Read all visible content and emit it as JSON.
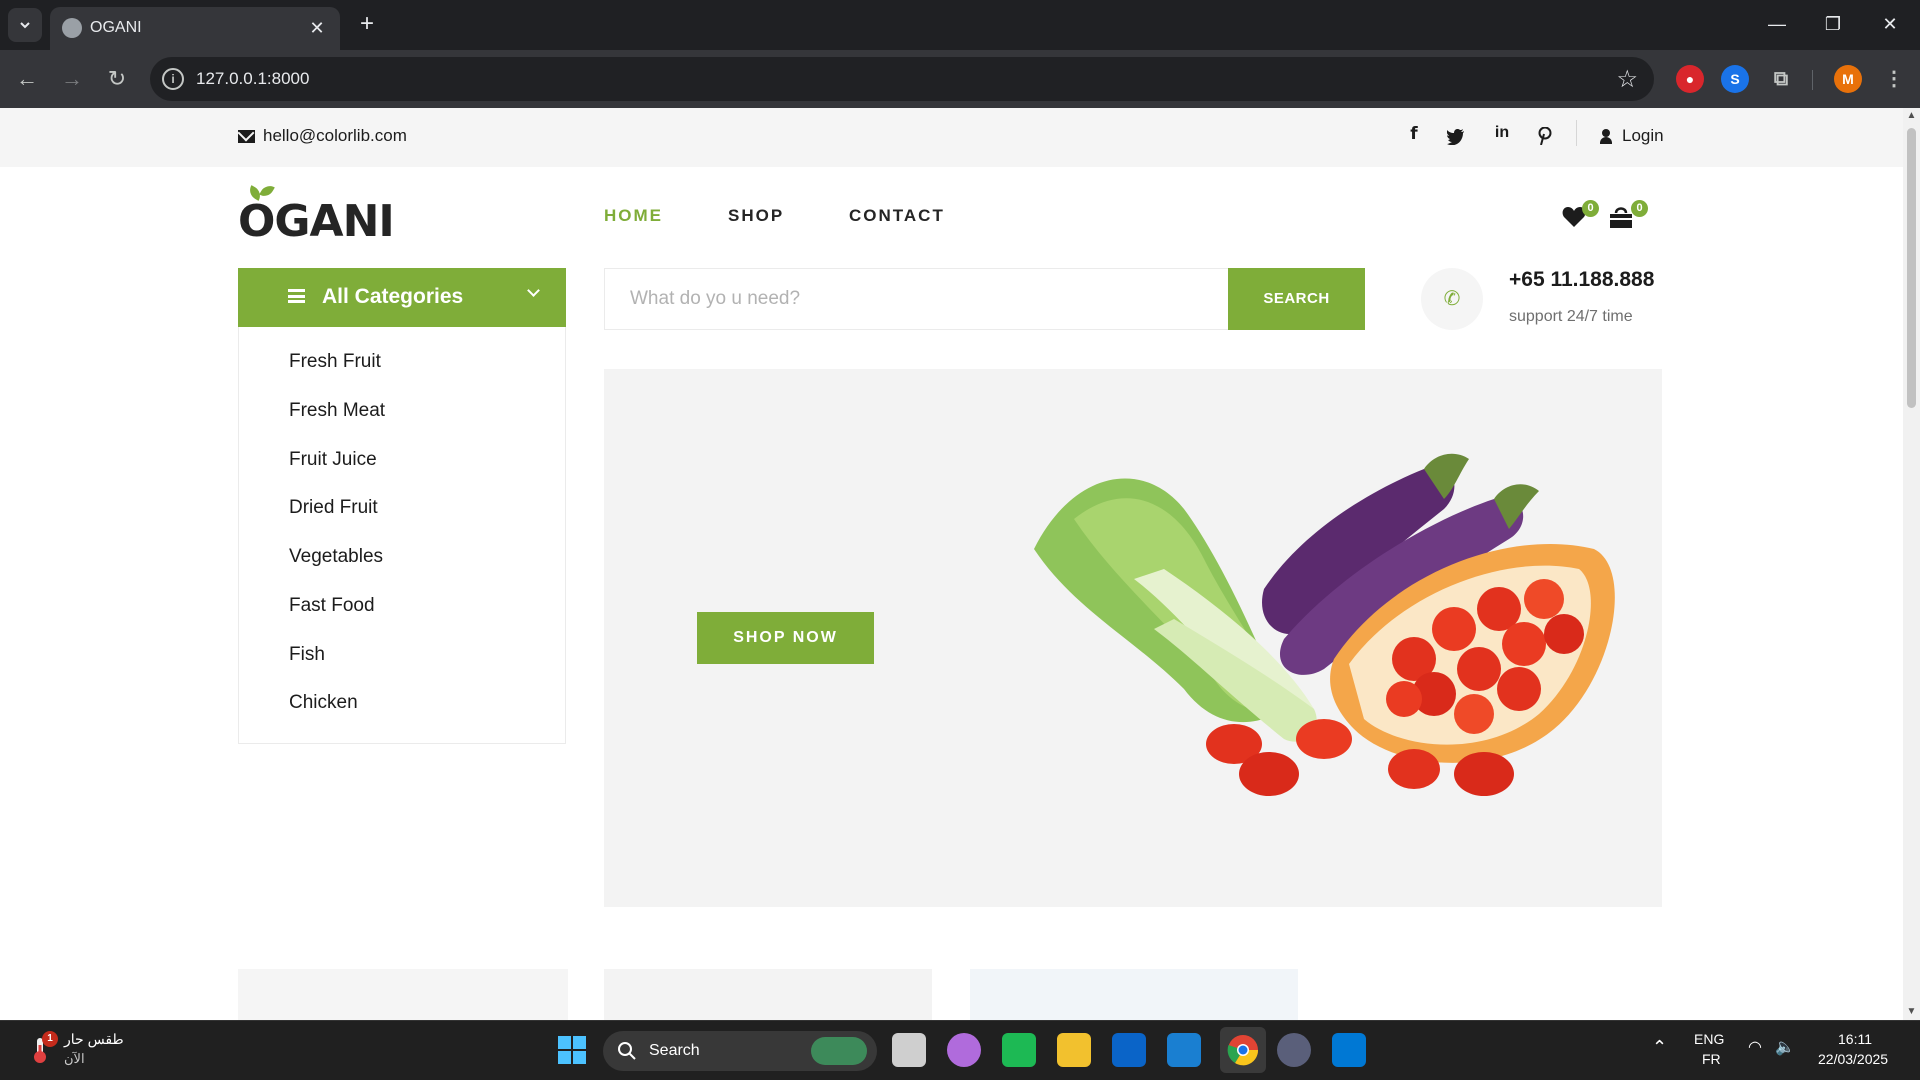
{
  "browser": {
    "tab_title": "OGANI",
    "url": "127.0.0.1:8000",
    "profile_initial": "M"
  },
  "header_top": {
    "email": "hello@colorlib.com",
    "social_icons": [
      "facebook-icon",
      "twitter-icon",
      "linkedin-icon",
      "pinterest-icon"
    ],
    "login_label": "Login"
  },
  "brand": {
    "logo_text": "OGANI",
    "accent_color": "#7fad39"
  },
  "nav": {
    "items": [
      {
        "label": "HOME",
        "active": true
      },
      {
        "label": "SHOP",
        "active": false
      },
      {
        "label": "CONTACT",
        "active": false
      }
    ],
    "wishlist_count": "0",
    "cart_count": "0"
  },
  "categories": {
    "title": "All Categories",
    "items": [
      "Fresh Fruit",
      "Fresh Meat",
      "Fruit Juice",
      "Dried Fruit",
      "Vegetables",
      "Fast Food",
      "Fish",
      "Chicken"
    ]
  },
  "search": {
    "placeholder": "What do yo u need?",
    "button_label": "SEARCH"
  },
  "contact": {
    "phone": "+65 11.188.888",
    "support_text": "support 24/7 time"
  },
  "hero": {
    "button_label": "SHOP NOW"
  },
  "taskbar": {
    "weather_title": "طقس حار",
    "weather_sub": "الآن",
    "weather_badge": "1",
    "search_label": "Search",
    "lang_primary": "ENG",
    "lang_secondary": "FR",
    "time": "16:11",
    "date": "22/03/2025"
  }
}
